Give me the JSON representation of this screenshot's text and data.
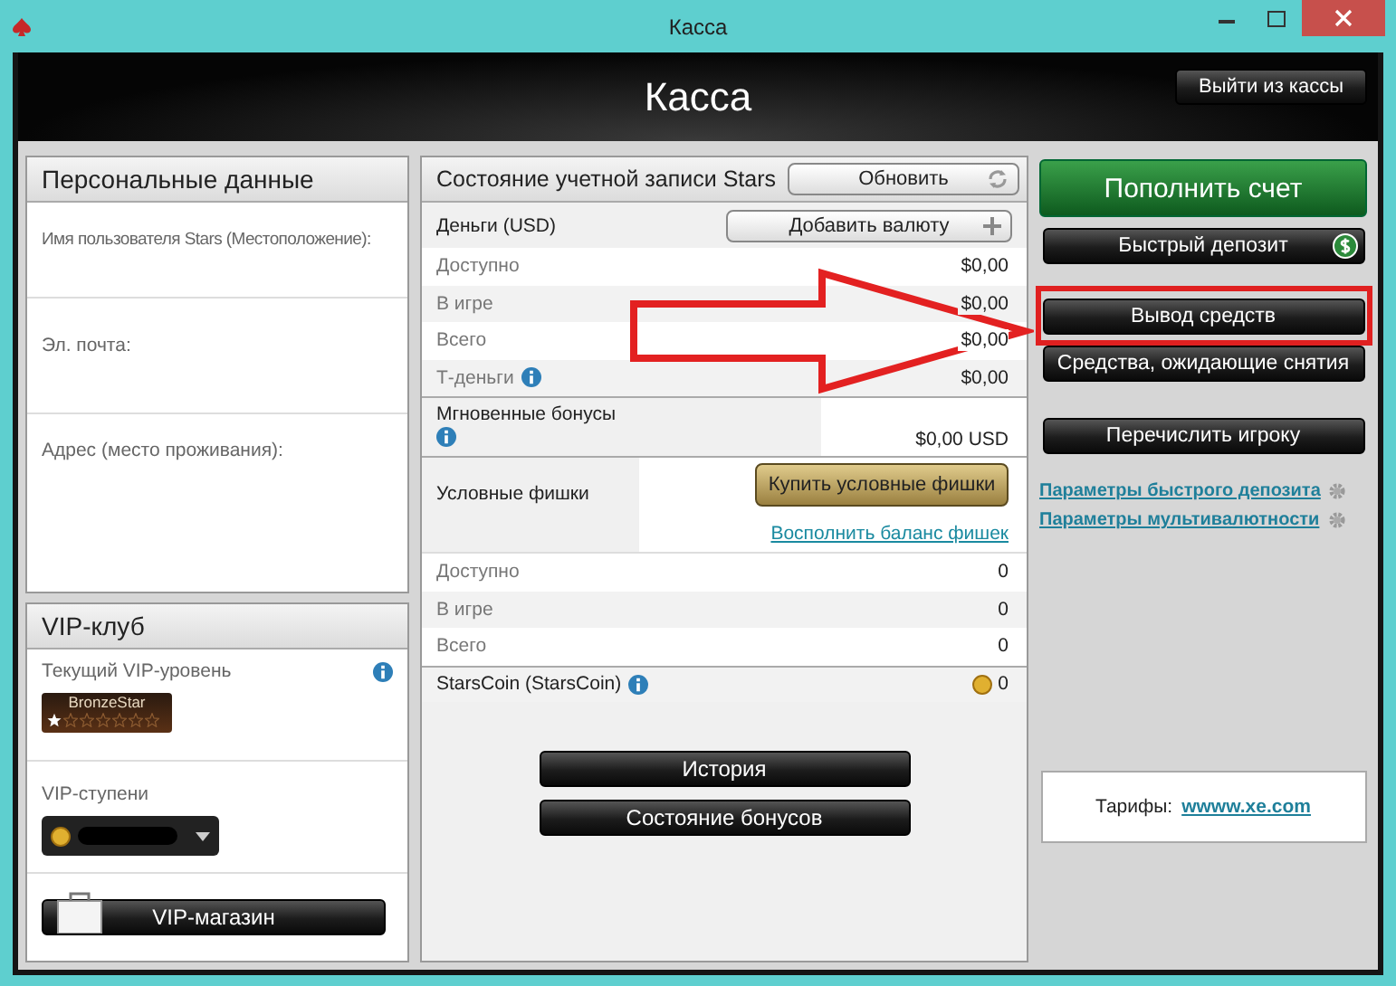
{
  "window": {
    "title": "Касса"
  },
  "header": {
    "title": "Касса",
    "exit_button": "Выйти из кассы"
  },
  "personal": {
    "title": "Персональные данные",
    "fields": [
      {
        "label": "Имя пользователя Stars (Местоположение):"
      },
      {
        "label": "Эл. почта:"
      },
      {
        "label": "Адрес (место проживания):"
      }
    ]
  },
  "vip": {
    "title": "VIP-клуб",
    "level_label": "Текущий VIP-уровень",
    "badge": "BronzeStar",
    "stars": 1,
    "steps_label": "VIP-ступени",
    "shop_button": "VIP-магазин"
  },
  "account": {
    "title": "Состояние учетной записи Stars",
    "refresh_button": "Обновить",
    "money_label": "Деньги (USD)",
    "add_currency_button": "Добавить валюту",
    "money_rows": [
      {
        "label": "Доступно",
        "value": "$0,00",
        "info": false
      },
      {
        "label": "В игре",
        "value": "$0,00",
        "info": false
      },
      {
        "label": "Всего",
        "value": "$0,00",
        "info": false
      },
      {
        "label": "Т-деньги",
        "value": "$0,00",
        "info": true
      }
    ],
    "instant_bonuses": {
      "label": "Мгновенные бонусы",
      "value": "$0,00 USD"
    },
    "chips": {
      "label": "Условные фишки",
      "buy_button": "Купить условные фишки",
      "link": "Восполнить баланс фишек"
    },
    "chip_rows": [
      {
        "label": "Доступно",
        "value": "0"
      },
      {
        "label": "В игре",
        "value": "0"
      },
      {
        "label": "Всего",
        "value": "0"
      }
    ],
    "starscoin": {
      "label": "StarsCoin (StarsCoin)",
      "value": "0"
    },
    "buttons": [
      "История",
      "Состояние бонусов"
    ]
  },
  "actions": {
    "deposit_button": "Пополнить счет",
    "quick_deposit_button": "Быстрый депозит",
    "buttons": [
      {
        "label": "Вывод средств",
        "highlighted": true
      },
      {
        "label": "Средства, ожидающие снятия",
        "highlighted": false
      }
    ],
    "transfer_button": "Перечислить игроку",
    "links": [
      "Параметры быстрого депозита",
      "Параметры мультивалютности"
    ],
    "rates_label": "Тарифы:",
    "rates_link": "wwww.xe.com"
  }
}
